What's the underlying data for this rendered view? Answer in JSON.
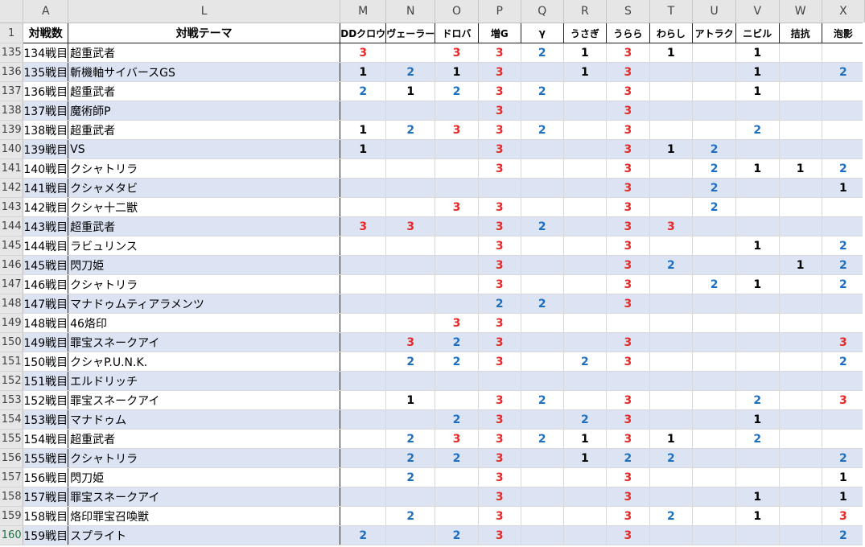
{
  "colors": {
    "count1": "#000000",
    "count2": "#1f6fbf",
    "count3": "#e52b2b",
    "band": "#dce3f3",
    "header_bg": "#e6e6e6"
  },
  "column_letters": [
    "A",
    "L",
    "M",
    "N",
    "O",
    "P",
    "Q",
    "R",
    "S",
    "T",
    "U",
    "V",
    "W",
    "X"
  ],
  "header_row": {
    "row_number": "1",
    "battle_label": "対戦数",
    "theme_label": "対戦テーマ",
    "cols": [
      "DDクロウ",
      "ヴェーラー",
      "ドロバ",
      "増G",
      "γ",
      "うさぎ",
      "うらら",
      "わらし",
      "アトラク",
      "ニビル",
      "拮抗",
      "泡影"
    ]
  },
  "rows": [
    {
      "num": "135",
      "battle": "134戦目",
      "theme": "超重武者",
      "vals": [
        "3",
        "",
        "3",
        "3",
        "2",
        "1",
        "3",
        "1",
        "",
        "1",
        "",
        ""
      ]
    },
    {
      "num": "136",
      "battle": "135戦目",
      "theme": "斬機軸サイバースGS",
      "vals": [
        "1",
        "2",
        "1",
        "3",
        "",
        "1",
        "3",
        "",
        "",
        "1",
        "",
        "2"
      ]
    },
    {
      "num": "137",
      "battle": "136戦目",
      "theme": "超重武者",
      "vals": [
        "2",
        "1",
        "2",
        "3",
        "2",
        "",
        "3",
        "",
        "",
        "1",
        "",
        ""
      ]
    },
    {
      "num": "138",
      "battle": "137戦目",
      "theme": "魔術師P",
      "vals": [
        "",
        "",
        "",
        "3",
        "",
        "",
        "3",
        "",
        "",
        "",
        "",
        ""
      ]
    },
    {
      "num": "139",
      "battle": "138戦目",
      "theme": "超重武者",
      "vals": [
        "1",
        "2",
        "3",
        "3",
        "2",
        "",
        "3",
        "",
        "",
        "2",
        "",
        ""
      ]
    },
    {
      "num": "140",
      "battle": "139戦目",
      "theme": "VS",
      "vals": [
        "1",
        "",
        "",
        "3",
        "",
        "",
        "3",
        "1",
        "2",
        "",
        "",
        ""
      ]
    },
    {
      "num": "141",
      "battle": "140戦目",
      "theme": "クシャトリラ",
      "vals": [
        "",
        "",
        "",
        "3",
        "",
        "",
        "3",
        "",
        "2",
        "1",
        "1",
        "2"
      ]
    },
    {
      "num": "142",
      "battle": "141戦目",
      "theme": "クシャメタビ",
      "vals": [
        "",
        "",
        "",
        "",
        "",
        "",
        "3",
        "",
        "2",
        "",
        "",
        "1"
      ]
    },
    {
      "num": "143",
      "battle": "142戦目",
      "theme": "クシャ十二獣",
      "vals": [
        "",
        "",
        "3",
        "3",
        "",
        "",
        "3",
        "",
        "2",
        "",
        "",
        ""
      ]
    },
    {
      "num": "144",
      "battle": "143戦目",
      "theme": "超重武者",
      "vals": [
        "3",
        "3",
        "",
        "3",
        "2",
        "",
        "3",
        "3",
        "",
        "",
        "",
        ""
      ]
    },
    {
      "num": "145",
      "battle": "144戦目",
      "theme": "ラビュリンス",
      "vals": [
        "",
        "",
        "",
        "3",
        "",
        "",
        "3",
        "",
        "",
        "1",
        "",
        "2"
      ]
    },
    {
      "num": "146",
      "battle": "145戦目",
      "theme": "閃刀姫",
      "vals": [
        "",
        "",
        "",
        "3",
        "",
        "",
        "3",
        "2",
        "",
        "",
        "1",
        "2"
      ]
    },
    {
      "num": "147",
      "battle": "146戦目",
      "theme": "クシャトリラ",
      "vals": [
        "",
        "",
        "",
        "3",
        "",
        "",
        "3",
        "",
        "2",
        "1",
        "",
        "2"
      ]
    },
    {
      "num": "148",
      "battle": "147戦目",
      "theme": "マナドゥムティアラメンツ",
      "vals": [
        "",
        "",
        "",
        "2",
        "2",
        "",
        "3",
        "",
        "",
        "",
        "",
        ""
      ]
    },
    {
      "num": "149",
      "battle": "148戦目",
      "theme": "46烙印",
      "vals": [
        "",
        "",
        "3",
        "3",
        "",
        "",
        "",
        "",
        "",
        "",
        "",
        ""
      ]
    },
    {
      "num": "150",
      "battle": "149戦目",
      "theme": "罪宝スネークアイ",
      "vals": [
        "",
        "3",
        "2",
        "3",
        "",
        "",
        "3",
        "",
        "",
        "",
        "",
        "3"
      ]
    },
    {
      "num": "151",
      "battle": "150戦目",
      "theme": "クシャP.U.N.K.",
      "vals": [
        "",
        "2",
        "2",
        "3",
        "",
        "2",
        "3",
        "",
        "",
        "",
        "",
        "2"
      ]
    },
    {
      "num": "152",
      "battle": "151戦目",
      "theme": "エルドリッチ",
      "vals": [
        "",
        "",
        "",
        "",
        "",
        "",
        "",
        "",
        "",
        "",
        "",
        ""
      ]
    },
    {
      "num": "153",
      "battle": "152戦目",
      "theme": "罪宝スネークアイ",
      "vals": [
        "",
        "1",
        "",
        "3",
        "2",
        "",
        "3",
        "",
        "",
        "2",
        "",
        "3"
      ]
    },
    {
      "num": "154",
      "battle": "153戦目",
      "theme": "マナドゥム",
      "vals": [
        "",
        "",
        "2",
        "3",
        "",
        "2",
        "3",
        "",
        "",
        "1",
        "",
        ""
      ]
    },
    {
      "num": "155",
      "battle": "154戦目",
      "theme": "超重武者",
      "vals": [
        "",
        "2",
        "3",
        "3",
        "2",
        "1",
        "3",
        "1",
        "",
        "2",
        "",
        ""
      ]
    },
    {
      "num": "156",
      "battle": "155戦目",
      "theme": "クシャトリラ",
      "vals": [
        "",
        "2",
        "2",
        "3",
        "",
        "1",
        "2",
        "2",
        "",
        "",
        "",
        "2"
      ]
    },
    {
      "num": "157",
      "battle": "156戦目",
      "theme": "閃刀姫",
      "vals": [
        "",
        "2",
        "",
        "3",
        "",
        "",
        "3",
        "",
        "",
        "",
        "",
        "1"
      ]
    },
    {
      "num": "158",
      "battle": "157戦目",
      "theme": "罪宝スネークアイ",
      "vals": [
        "",
        "",
        "",
        "3",
        "",
        "",
        "3",
        "",
        "",
        "1",
        "",
        "1"
      ]
    },
    {
      "num": "159",
      "battle": "158戦目",
      "theme": "烙印罪宝召喚獣",
      "vals": [
        "",
        "2",
        "",
        "3",
        "",
        "",
        "3",
        "2",
        "",
        "1",
        "",
        "3"
      ]
    },
    {
      "num": "160",
      "battle": "159戦目",
      "theme": "スプライト",
      "vals": [
        "2",
        "",
        "2",
        "3",
        "",
        "",
        "3",
        "",
        "",
        "",
        "",
        "2"
      ]
    }
  ]
}
